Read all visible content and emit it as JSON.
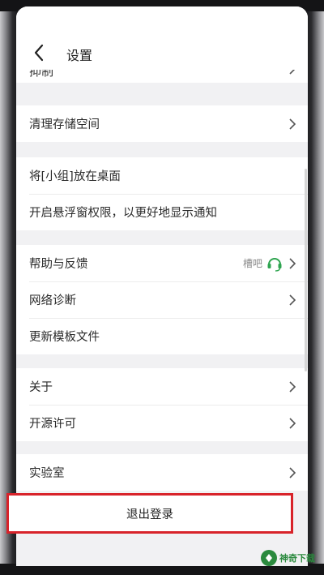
{
  "header": {
    "title": "设置",
    "back_icon": "chevron-left-icon"
  },
  "cut_row": {
    "label": "抑制"
  },
  "sections": [
    {
      "items": [
        {
          "label": "清理存储空间",
          "chevron": true
        }
      ]
    },
    {
      "items": [
        {
          "label": "将[小组]放在桌面",
          "chevron": false
        },
        {
          "label": "开启悬浮窗权限，以更好地显示通知",
          "chevron": false
        }
      ]
    },
    {
      "items": [
        {
          "label": "帮助与反馈",
          "chevron": true,
          "extra": "槽吧",
          "extra_icon": "headset-icon"
        },
        {
          "label": "网络诊断",
          "chevron": true
        },
        {
          "label": "更新模板文件",
          "chevron": false
        }
      ]
    },
    {
      "items": [
        {
          "label": "关于",
          "chevron": true
        },
        {
          "label": "开源许可",
          "chevron": true
        }
      ]
    },
    {
      "items": [
        {
          "label": "实验室",
          "chevron": true
        }
      ]
    }
  ],
  "logout": {
    "label": "退出登录",
    "highlight_color": "#d8232a"
  },
  "watermark": {
    "text": "神奇下载"
  },
  "colors": {
    "background": "#f1f1f3",
    "card": "#ffffff",
    "headset_green": "#2ea44f",
    "chevron": "#555555"
  }
}
